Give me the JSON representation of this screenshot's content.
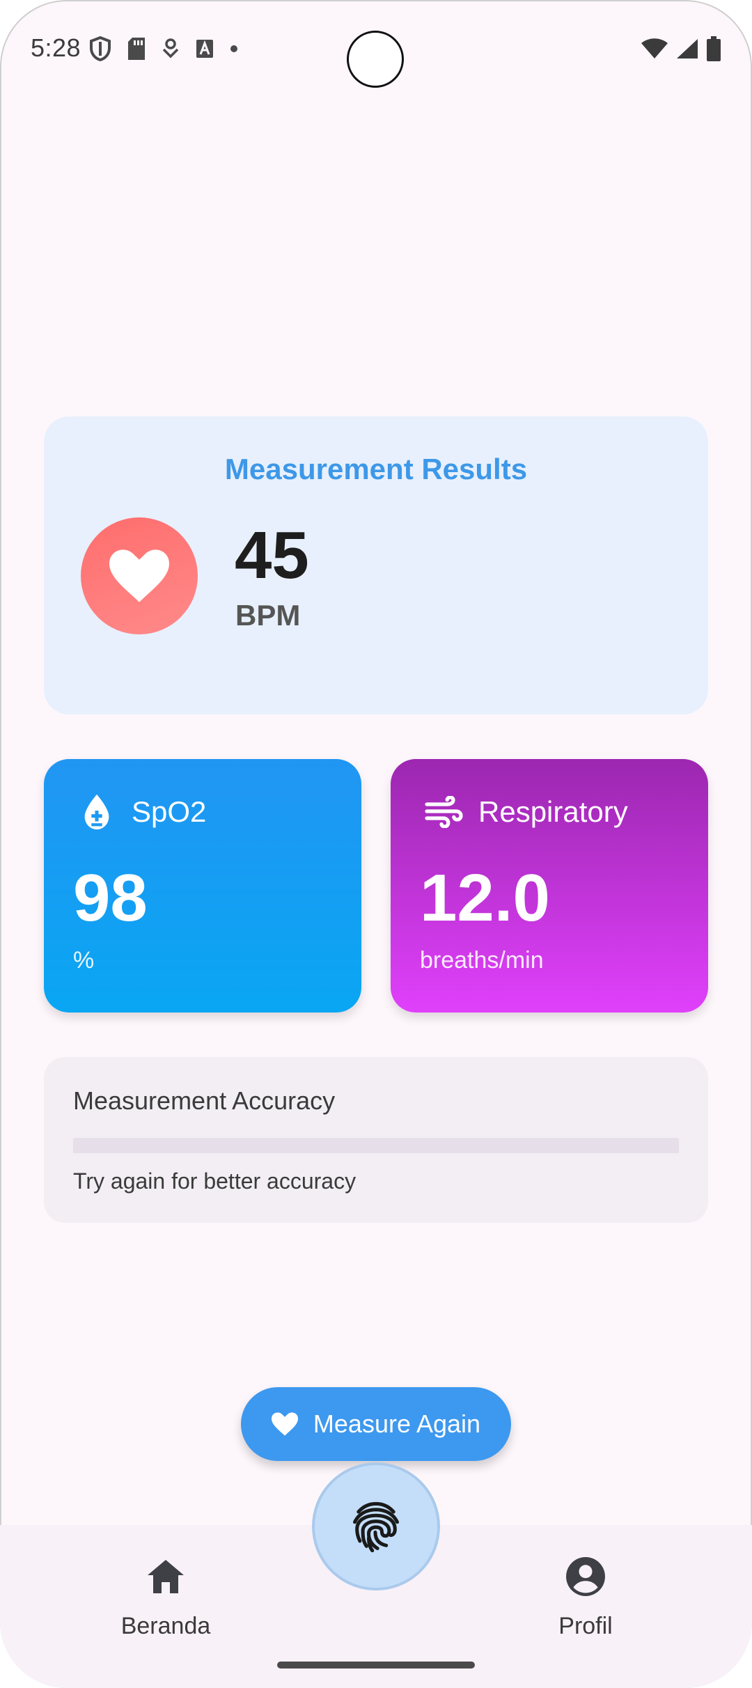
{
  "status_bar": {
    "time": "5:28"
  },
  "results": {
    "title": "Measurement Results",
    "heart_rate": "45",
    "heart_rate_unit": "BPM"
  },
  "spo2": {
    "label": "SpO2",
    "value": "98",
    "unit": "%"
  },
  "respiratory": {
    "label": "Respiratory",
    "value": "12.0",
    "unit": "breaths/min"
  },
  "accuracy": {
    "title": "Measurement Accuracy",
    "progress_fraction": 0,
    "hint": "Try again for better accuracy"
  },
  "actions": {
    "measure_again_label": "Measure Again"
  },
  "bottom_nav": {
    "home_label": "Beranda",
    "profile_label": "Profil"
  },
  "colors": {
    "accent_blue": "#3d98ef",
    "heart_red": "#ff6d6d",
    "spo2_gradient": [
      "#2196f3",
      "#09a6f3"
    ],
    "respiratory_gradient": [
      "#9c27b0",
      "#e040fb"
    ]
  },
  "icons": {
    "heart": "heart-icon",
    "spo2": "blood-drop-icon",
    "respiratory": "wind-icon",
    "home": "home-icon",
    "profile": "account-circle-icon",
    "fab": "fingerprint-icon"
  }
}
